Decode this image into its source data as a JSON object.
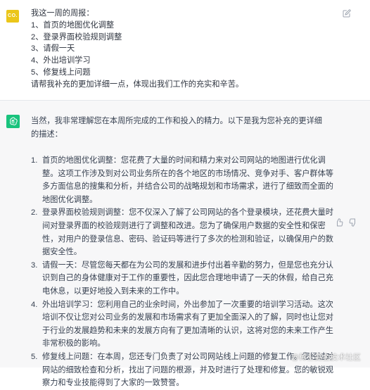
{
  "user": {
    "avatar_text": "CO.",
    "lines": [
      "我这一周的周报：",
      "1、首页的地图优化调整",
      "2、登录界面校验规则调整",
      "3、请假一天",
      "4、外出培训学习",
      "5、修复线上问题",
      "请帮我补充的更加详细一点，体现出我们工作的充实和辛苦。"
    ]
  },
  "assistant": {
    "intro": "当然，我非常理解您在本周所完成的工作和投入的精力。以下是我为您补充的更详细的描述：",
    "items": [
      {
        "num": "1.",
        "text": "首页的地图优化调整：您花费了大量的时间和精力来对公司网站的地图进行优化调整。这项工作涉及到对公司业务所在的各个地区的市场情况、竞争对手、客户群体等多方面信息的搜集和分析，并结合公司的战略规划和市场需求，进行了细致而全面的地图优化调整。"
      },
      {
        "num": "2.",
        "text": "登录界面校验规则调整：您不仅深入了解了公司网站的各个登录模块，还花费大量时间对登录界面的校验规则进行了调整和改进。您为了确保用户数据的安全性和保密性，对用户的登录信息、密码、验证码等进行了多次的检测和验证，以确保用户的数据安全性。"
      },
      {
        "num": "3.",
        "text": "请假一天：尽管您每天都在为公司的发展和进步付出着辛勤的努力，但是您也充分认识到自己的身体健康对于工作的重要性，因此您合理地申请了一天的休假，给自己充电休息，以更好地投入到未来的工作中。"
      },
      {
        "num": "4.",
        "text": "外出培训学习：您利用自己的业余时间，外出参加了一次重要的培训学习活动。这次培训不仅让您对公司业务的发展和市场需求有了更加全面深入的了解，同时也让您对于行业的发展趋势和未来的发展方向有了更加清晰的认识，这将对您的未来工作产生非常积极的影响。"
      },
      {
        "num": "5.",
        "text": "修复线上问题：在本周，您还专门负责了对公司网站线上问题的修复工作。您经过对网站的细致检查和分析，找出了问题的根源，并及时进行了处理和修复。您的敏锐观察力和专业技能得到了大家的一致赞誉。"
      }
    ]
  },
  "watermark": {
    "text": "@稀土掘金技术社区"
  },
  "colors": {
    "user_avatar": "#ebc61a",
    "gpt_avatar": "#19c37d",
    "assistant_bg": "#f7f7f8",
    "text": "#374151"
  },
  "icons": {
    "edit": "edit-icon",
    "thumb_up": "thumb-up-icon",
    "thumb_down": "thumb-down-icon",
    "gpt_logo": "openai-logo-icon"
  }
}
